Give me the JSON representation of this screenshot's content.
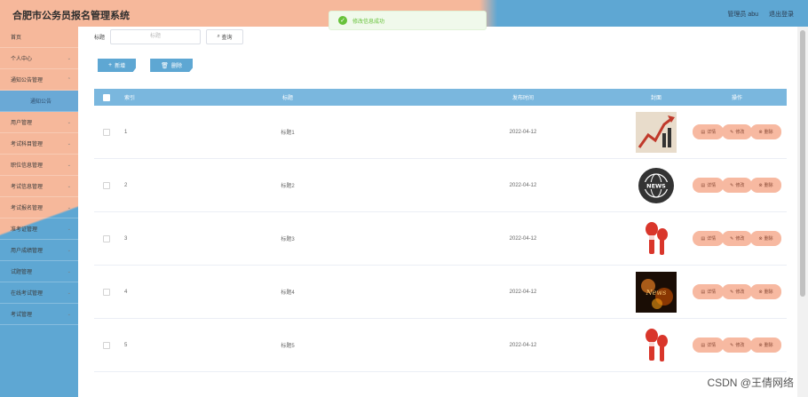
{
  "header": {
    "title": "合肥市公务员报名管理系统",
    "user_label": "管理员 abu",
    "logout_label": "退出登录"
  },
  "toast": {
    "message": "修改信息成功"
  },
  "sidebar": {
    "items": [
      {
        "label": "首页",
        "has_children": false
      },
      {
        "label": "个人中心",
        "has_children": true
      },
      {
        "label": "通知公告管理",
        "has_children": true
      },
      {
        "label": "通知公告",
        "sub": true
      },
      {
        "label": "用户管理",
        "has_children": true
      },
      {
        "label": "考试科目管理",
        "has_children": true
      },
      {
        "label": "职位信息管理",
        "has_children": true
      },
      {
        "label": "考试信息管理",
        "has_children": true
      },
      {
        "label": "考试报名管理",
        "has_children": true
      },
      {
        "label": "准考证管理",
        "has_children": true
      },
      {
        "label": "用户成绩管理",
        "has_children": true
      },
      {
        "label": "试题管理",
        "has_children": true
      },
      {
        "label": "在线考试管理",
        "has_children": true
      },
      {
        "label": "考试管理",
        "has_children": true
      }
    ]
  },
  "search": {
    "label": "标题",
    "placeholder": "标题",
    "button": "查询"
  },
  "actions": {
    "add": "新增",
    "delete": "删除"
  },
  "table": {
    "headers": {
      "index": "索引",
      "title": "标题",
      "date": "发布时间",
      "image": "封面",
      "ops": "操作"
    },
    "ops": {
      "detail": "详情",
      "edit": "修改",
      "delete": "删除"
    },
    "rows": [
      {
        "index": "1",
        "title": "标题1",
        "date": "2022-04-12",
        "image": "chart-arrow-image"
      },
      {
        "index": "2",
        "title": "标题2",
        "date": "2022-04-12",
        "image": "news-globe-image"
      },
      {
        "index": "3",
        "title": "标题3",
        "date": "2022-04-12",
        "image": "microphone-image"
      },
      {
        "index": "4",
        "title": "标题4",
        "date": "2022-04-12",
        "image": "dark-news-image"
      },
      {
        "index": "5",
        "title": "标题5",
        "date": "2022-04-12",
        "image": "microphone-image"
      }
    ]
  },
  "watermark": "CSDN @王倩网络"
}
